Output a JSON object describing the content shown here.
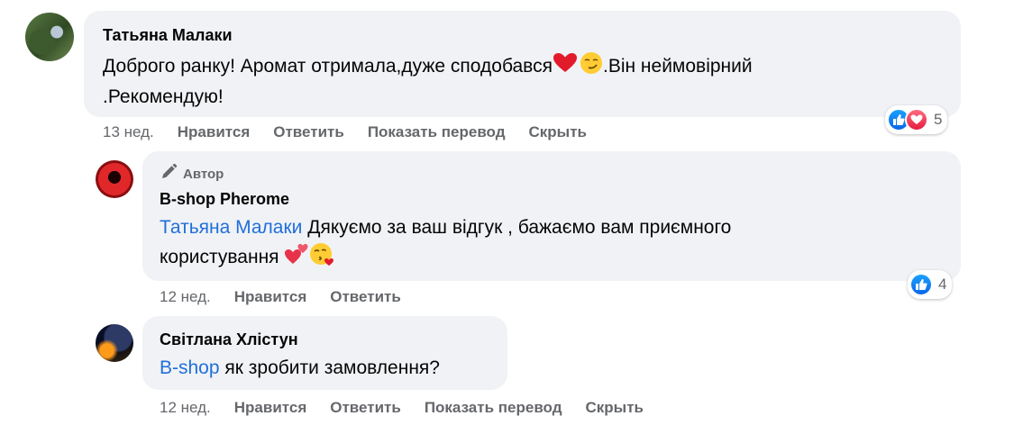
{
  "comments": [
    {
      "name": "Татьяна Малаки",
      "text_line1": "Доброго ранку! Аромат отримала,дуже сподобався",
      "text_mid": ".Він неймовірний",
      "text_line2": ".Рекомендую!",
      "time": "13 нед.",
      "actions": [
        "Нравится",
        "Ответить",
        "Показать перевод",
        "Скрыть"
      ],
      "reactions": {
        "types": [
          "like-icon",
          "love-icon"
        ],
        "count": "5"
      }
    },
    {
      "badge": "Автор",
      "name": "B-shop Pherome",
      "mention": "Татьяна Малаки",
      "text_line1": " Дякуємо за ваш відгук , бажаємо вам приємного",
      "text_line2": "користування",
      "time": "12 нед.",
      "actions": [
        "Нравится",
        "Ответить"
      ],
      "reactions": {
        "types": [
          "like-icon"
        ],
        "count": "4"
      }
    },
    {
      "name": "Світлана Хлістун",
      "mention": "B-shop",
      "text": " як зробити замовлення?",
      "time": "12 нед.",
      "actions": [
        "Нравится",
        "Ответить",
        "Показать перевод",
        "Скрыть"
      ]
    }
  ],
  "colors": {
    "bubble": "#f0f2f5",
    "mention": "#216fdb",
    "meta": "#65676b",
    "like": "#0a66e8",
    "love": "#e41e3f"
  }
}
